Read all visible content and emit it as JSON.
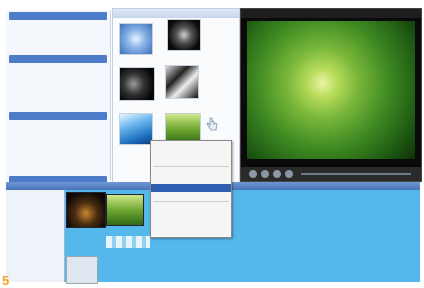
{
  "app": {
    "window_title": "",
    "preview_title": ""
  },
  "tasks_pane": {
    "groups": [
      {
        "heading": "",
        "links": [
          "",
          "",
          "",
          ""
        ]
      },
      {
        "heading": "",
        "links": [
          "",
          "",
          "",
          "",
          "",
          ""
        ]
      },
      {
        "heading": "",
        "links": [
          "",
          "",
          "",
          "",
          "",
          "",
          ""
        ]
      },
      {
        "heading": "",
        "links": [
          "",
          "",
          "",
          "",
          ""
        ]
      }
    ]
  },
  "collection": {
    "title": "",
    "items": [
      {
        "label": "",
        "icon": "blue-flower-thumbnail"
      },
      {
        "label": "",
        "icon": "dark-thumbnail"
      },
      {
        "label": "",
        "icon": "night-thumbnail"
      },
      {
        "label": "",
        "icon": "bw-photo-thumbnail"
      },
      {
        "label": "",
        "icon": "blue-water-thumbnail"
      },
      {
        "label": "",
        "icon": "green-grass-thumbnail"
      }
    ]
  },
  "context_menu": {
    "items": [
      "",
      "",
      "",
      "",
      "",
      "",
      "",
      "",
      ""
    ],
    "selected_index": 5
  },
  "timeline": {
    "tracks": [
      "",
      "",
      ""
    ]
  },
  "colors": {
    "accent": "#4d7cc8",
    "timeline": "#55b8ea",
    "step_number": "#f0a020"
  },
  "step_number": "5"
}
